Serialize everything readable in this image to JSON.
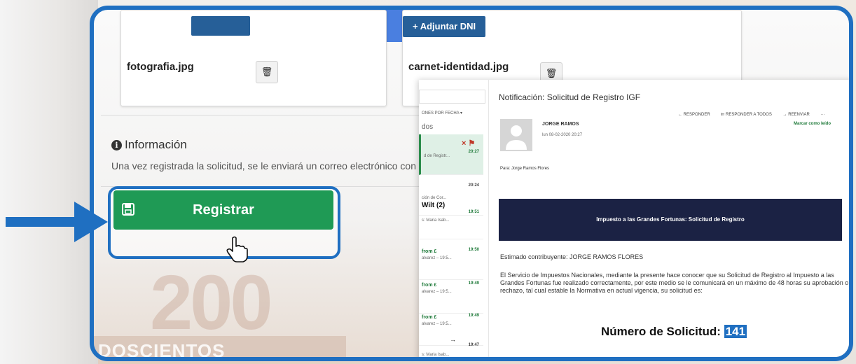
{
  "colors": {
    "accent_blue": "#1f6fc1",
    "attach_blue": "#265f98",
    "register_green": "#1f9a55",
    "banner_navy": "#1b2244"
  },
  "uploads": {
    "attach_dni_label": "+ Adjuntar DNI",
    "photo_file": "fotografia.jpg",
    "id_file": "carnet-identidad.jpg",
    "delete_icon": "trash-icon"
  },
  "info": {
    "title": "Información",
    "text": "Una vez registrada la solicitud, se le enviará un correo electrónico con"
  },
  "register": {
    "label": "Registrar",
    "icon": "save-icon"
  },
  "watermark": {
    "number": "200",
    "words": "DOSCIENTOS BOLIVIANOS"
  },
  "email": {
    "list": {
      "sort_label": "ONES POR FECHA ▾",
      "filter_label": "dos",
      "items": [
        {
          "from": "× ⚑",
          "sub": "d de Registr...",
          "time": "20:27"
        },
        {
          "from": "",
          "sub": "ción de Cor...",
          "time": "20:24"
        },
        {
          "from": "Wilt (2)",
          "sub": "s: Maria Isab...",
          "time": "19:51"
        },
        {
          "from": "from £",
          "sub": "alvarez – 19:5...",
          "time": "19:50"
        },
        {
          "from": "from £",
          "sub": "alvarez – 19:5...",
          "time": "19:49"
        },
        {
          "from": "from £",
          "sub": "alvarez – 19:5...",
          "time": "19:49"
        },
        {
          "from": "→",
          "sub": "s: Maria Isab...",
          "time": "19:47"
        }
      ]
    },
    "subject": "Notificación: Solicitud de Registro IGF",
    "actions": [
      "← RESPONDER",
      "⇇ RESPONDER A TODOS",
      "→ REENVIAR",
      "···"
    ],
    "mark_read": "Marcar como leído",
    "sender": "JORGE RAMOS",
    "date": "lun 08-02-2020 20:27",
    "to": "Para:  Jorge Ramos Flores",
    "banner": "Impuesto a las Grandes Fortunas: Solicitud de Registro",
    "greeting": "Estimado contribuyente: JORGE RAMOS FLORES",
    "body": "El Servicio de Impuestos Nacionales, mediante la presente hace conocer que su Solicitud de Registro al Impuesto a las Grandes Fortunas fue realizado correctamente, por este medio se le comunicará en un máximo de 48 horas su aprobación o rechazo, tal cual estable la Normativa en actual vigencia, su solicitud es:",
    "request_label": "Número de Solicitud:",
    "request_number": "141"
  }
}
